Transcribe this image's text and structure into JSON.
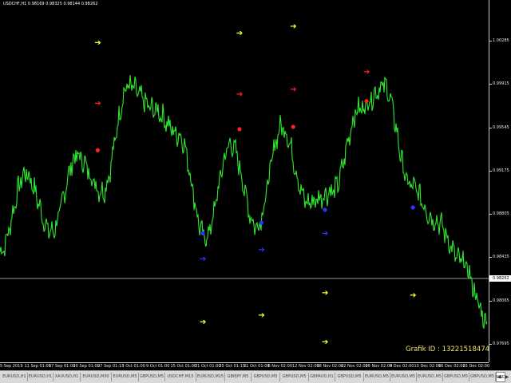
{
  "chart": {
    "title": "USDCHF,H1  0.98169 0.98325 0.98144 0.98262",
    "grafik_id": "Grafik ID : 132215184747766307",
    "current_price": "0.98262",
    "colors": {
      "background": "#000000",
      "line": "#2ee82e",
      "sell_marker": "#ff2020",
      "buy_marker": "#2b35ff",
      "exit_arrow": "#ffff33",
      "price_line": "#c8c8c8"
    }
  },
  "price_scale": [
    {
      "label": "1.00285",
      "value": 1.00285
    },
    {
      "label": "0.99915",
      "value": 0.99915
    },
    {
      "label": "0.99545",
      "value": 0.99545
    },
    {
      "label": "0.99175",
      "value": 0.99175
    },
    {
      "label": "0.98805",
      "value": 0.98805
    },
    {
      "label": "0.98435",
      "value": 0.98435
    },
    {
      "label": "0.98065",
      "value": 0.98065
    },
    {
      "label": "0.97695",
      "value": 0.97695
    }
  ],
  "time_axis": [
    "5 Sep 2019",
    "11 Sep 01:00",
    "17 Sep 01:00",
    "20 Sep 01:00",
    "27 Sep 01:15",
    "3 Oct 01:00",
    "9 Oct 01:00",
    "15 Oct 01:00",
    "21 Oct 01:00",
    "25 Oct 01:15",
    "31 Oct 01:00",
    "6 Nov 02:00",
    "12 Nov 02:00",
    "18 Nov 02:00",
    "22 Nov 02:00",
    "28 Nov 02:00",
    "4 Dec 02:00",
    "10 Dec 02:00",
    "16 Dec 02:00",
    "23 Dec 02:00"
  ],
  "tabs": [
    {
      "label": "EURUSD,H1",
      "active": false
    },
    {
      "label": "EURUSD,H1",
      "active": false
    },
    {
      "label": "XAUUSD,H1",
      "active": false
    },
    {
      "label": "EURUSD,M30",
      "active": false
    },
    {
      "label": "EURUSD,M5",
      "active": false
    },
    {
      "label": "GBPUSD,M5",
      "active": false
    },
    {
      "label": "USDCHF,M15",
      "active": false
    },
    {
      "label": "EURUSD,M15",
      "active": false
    },
    {
      "label": "GBPJPY,M5",
      "active": false
    },
    {
      "label": "GBPUSD,M5",
      "active": false
    },
    {
      "label": "GBPUSD,M5",
      "active": false
    },
    {
      "label": "GBPAUD,H1",
      "active": false
    },
    {
      "label": "GBPUSD,M5",
      "active": false
    },
    {
      "label": "EURUSD,M5",
      "active": false
    },
    {
      "label": "EURUSD,M5",
      "active": false
    },
    {
      "label": "EURUSD,M5",
      "active": false
    },
    {
      "label": "GBPUSD,M5",
      "active": false
    },
    {
      "label": "GBPUSD,M5",
      "active": false
    },
    {
      "label": "USC",
      "active": true
    }
  ],
  "chart_data": {
    "type": "line",
    "title": "USDCHF,H1  0.98169 0.98325 0.98144 0.98262",
    "xlabel": "",
    "ylabel": "",
    "ylim": [
      0.9755,
      1.0058
    ],
    "x": [
      "5 Sep 2019",
      "11 Sep 01:00",
      "17 Sep 01:00",
      "20 Sep 01:00",
      "27 Sep 01:15",
      "3 Oct 01:00",
      "9 Oct 01:00",
      "15 Oct 01:00",
      "21 Oct 01:00",
      "25 Oct 01:15",
      "31 Oct 01:00",
      "6 Nov 02:00",
      "12 Nov 02:00",
      "18 Nov 02:00",
      "22 Nov 02:00",
      "28 Nov 02:00",
      "4 Dec 02:00",
      "10 Dec 02:00",
      "16 Dec 02:00",
      "23 Dec 02:00"
    ],
    "series": [
      {
        "values": [
          0.9848,
          0.9915,
          0.9865,
          0.993,
          0.99,
          0.999,
          0.997,
          0.9948,
          0.986,
          0.994,
          0.987,
          0.9955,
          0.989,
          0.99,
          0.997,
          0.999,
          0.9905,
          0.9875,
          0.984,
          0.979
        ]
      }
    ],
    "markers": {
      "sell": [
        [
          0.2,
          0.9935
        ],
        [
          0.49,
          0.9953
        ],
        [
          0.6,
          0.9955
        ],
        [
          0.75,
          0.9977
        ]
      ],
      "buy": [
        [
          0.415,
          0.9864
        ],
        [
          0.535,
          0.9873
        ],
        [
          0.665,
          0.9884
        ],
        [
          0.845,
          0.9886
        ]
      ],
      "exit_arrows": [
        [
          0.2,
          1.0027
        ],
        [
          0.49,
          1.0035
        ],
        [
          0.6,
          1.0041
        ],
        [
          0.415,
          0.9788
        ],
        [
          0.535,
          0.9794
        ],
        [
          0.665,
          0.9813
        ],
        [
          0.665,
          0.9771
        ],
        [
          0.845,
          0.9811
        ]
      ],
      "sell_arrows": [
        [
          0.2,
          0.9975
        ],
        [
          0.49,
          0.9983
        ],
        [
          0.6,
          0.9987
        ],
        [
          0.75,
          1.0002
        ]
      ],
      "buy_arrows": [
        [
          0.415,
          0.9842
        ],
        [
          0.535,
          0.985
        ],
        [
          0.665,
          0.9864
        ]
      ]
    }
  }
}
